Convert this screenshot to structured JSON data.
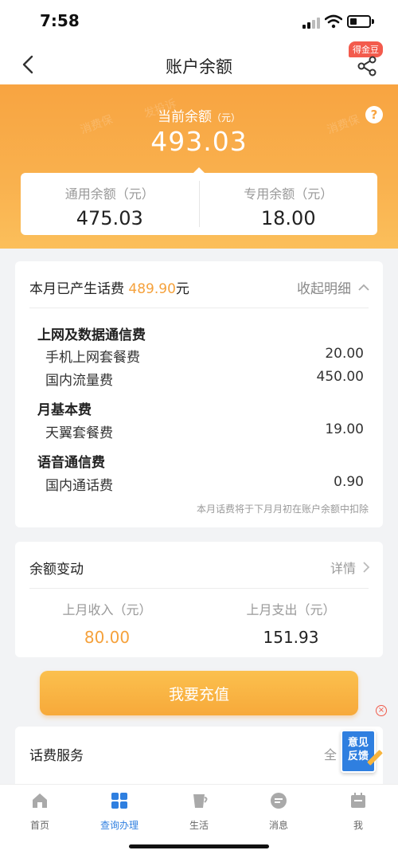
{
  "status_bar": {
    "time": "7:58"
  },
  "nav": {
    "title": "账户余额",
    "badge": "得金豆"
  },
  "hero": {
    "label": "当前余额",
    "unit": "（元）",
    "amount": "493.03",
    "help": "?",
    "general": {
      "label": "通用余额（元）",
      "value": "475.03"
    },
    "special": {
      "label": "专用余额（元）",
      "value": "18.00"
    },
    "watermarks": [
      "消费保",
      "发投诉"
    ]
  },
  "bill": {
    "header_prefix": "本月已产生话费",
    "header_amount": "489.90",
    "header_suffix": "元",
    "collapse_label": "收起明细",
    "categories": [
      {
        "title": "上网及数据通信费",
        "items": [
          {
            "name": "手机上网套餐费",
            "amount": "20.00"
          },
          {
            "name": "国内流量费",
            "amount": "450.00"
          }
        ]
      },
      {
        "title": "月基本费",
        "items": [
          {
            "name": "天翼套餐费",
            "amount": "19.00"
          }
        ]
      },
      {
        "title": "语音通信费",
        "items": [
          {
            "name": "国内通话费",
            "amount": "0.90"
          }
        ]
      }
    ],
    "note": "本月话费将于下月月初在账户余额中扣除"
  },
  "balance_change": {
    "title": "余额变动",
    "detail_label": "详情",
    "income": {
      "label": "上月收入（元）",
      "value": "80.00"
    },
    "expense": {
      "label": "上月支出（元）",
      "value": "151.93"
    }
  },
  "recharge": {
    "label": "我要充值"
  },
  "service": {
    "title": "话费服务",
    "more": "全"
  },
  "feedback": {
    "line1": "意见",
    "line2": "反馈"
  },
  "tabs": [
    {
      "label": "首页",
      "icon": "home-icon"
    },
    {
      "label": "查询办理",
      "icon": "grid-icon"
    },
    {
      "label": "生活",
      "icon": "life-icon"
    },
    {
      "label": "消息",
      "icon": "message-icon"
    },
    {
      "label": "我",
      "icon": "profile-icon"
    }
  ],
  "colors": {
    "accent": "#f8a441",
    "highlight": "#f5a13b",
    "active_tab": "#2f7fe0"
  }
}
